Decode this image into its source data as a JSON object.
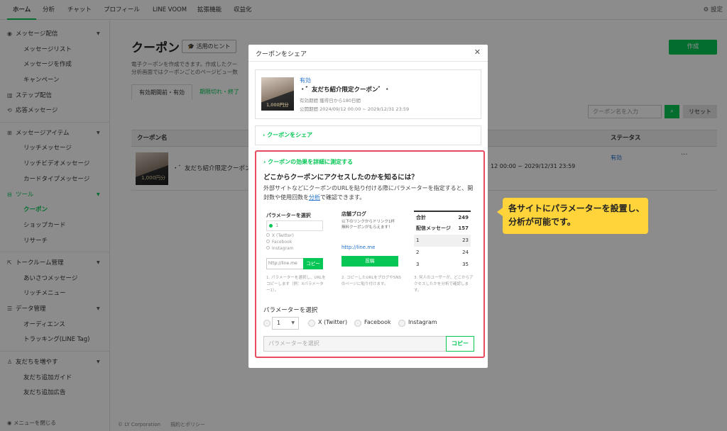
{
  "topnav": {
    "tabs": [
      "ホーム",
      "分析",
      "チャット",
      "プロフィール",
      "LINE VOOM",
      "拡張機能",
      "収益化"
    ],
    "settings": "設定"
  },
  "sidebar": {
    "sections": [
      {
        "label": "メッセージ配信",
        "items": [
          "メッセージリスト",
          "メッセージを作成",
          "キャンペーン"
        ]
      },
      {
        "label": "ステップ配信"
      },
      {
        "label": "応答メッセージ"
      },
      {
        "label": "メッセージアイテム",
        "items": [
          "リッチメッセージ",
          "リッチビデオメッセージ",
          "カードタイプメッセージ"
        ]
      },
      {
        "label": "ツール",
        "items": [
          "クーポン",
          "ショップカード",
          "リサーチ"
        ]
      },
      {
        "label": "トークルーム管理",
        "items": [
          "あいさつメッセージ",
          "リッチメニュー"
        ]
      },
      {
        "label": "データ管理",
        "items": [
          "オーディエンス",
          "トラッキング(LINE Tag)"
        ]
      },
      {
        "label": "友だちを増やす",
        "items": [
          "友だち追加ガイド",
          "友だち追加広告"
        ]
      }
    ],
    "close_label": "メニューを閉じる"
  },
  "main": {
    "title": "クーポン",
    "hint_button": "活用のヒント",
    "create_button": "作成",
    "desc_line1": "電子クーポンを作成できます。作成したクー",
    "desc_line2": "分析画面ではクーポンごとのページビュー数",
    "tab_active": "有効期間前・有効",
    "tab_other": "期限切れ・終了",
    "search_placeholder": "クーポン名を入力",
    "reset_button": "リセット",
    "col_name": "クーポン名",
    "col_status": "ステータス",
    "row_name": "・゛友だち紹介限定クーポン゛・",
    "row_period": "12 00:00 ~ 2029/12/31 23:59",
    "row_status": "有効",
    "row_more": "···",
    "footer": "© LY Corporation　　規約とポリシー"
  },
  "modal": {
    "title": "クーポンをシェア",
    "close": "✕",
    "card_status": "有効",
    "card_name": "・゛友だち紹介限定クーポン゛・",
    "card_line1": "有効期間 獲得日から180日間",
    "card_line2": "公開期間 2024/09/12 00:00 ~ 2029/12/31 23:59",
    "thumb_text": "1,000円分",
    "share_section": "クーポンをシェア",
    "measure_section": "クーポンの効果を詳細に測定する",
    "question": "どこからクーポンにアクセスしたのかを知るには？",
    "desc_before": "外部サイトなどにクーポンのURLを貼り付ける際にパラメーターを指定すると、開封数や使用回数を",
    "desc_link": "分析",
    "desc_after": "で確認できます。",
    "illus": {
      "c1_heading": "パラメーターを選択",
      "c1_select": "1",
      "c1_opts": [
        "X (Twitter)",
        "Facebook",
        "Instagram"
      ],
      "c1_url": "http://line.me",
      "c1_copy": "コピー",
      "c1_caption": "1. パラメーターを選択し、URLをコピーします（例：Xパラメーター1）。",
      "c2_heading": "店舗ブログ",
      "c2_text": "以下のリンクからドリンク1杯無料クーポンがもらえます！",
      "c2_link": "http://line.me",
      "c2_button": "投稿",
      "c2_caption": "2. コピーしたURLをブログやSNSのページに貼り付けます。",
      "table": [
        {
          "label": "合計",
          "value": "249"
        },
        {
          "label": "配信メッセージ",
          "value": "157"
        },
        {
          "label": "1",
          "value": "23"
        },
        {
          "label": "2",
          "value": "24"
        },
        {
          "label": "3",
          "value": "35"
        }
      ],
      "c3_caption": "3. 何人のユーザーが、どこからアクセスしたかを分析で確認します。"
    },
    "param_heading": "パラメーターを選択",
    "param_select": "1",
    "param_options": [
      "X (Twitter)",
      "Facebook",
      "Instagram"
    ],
    "param_placeholder": "パラメーターを選択",
    "param_copy": "コピー"
  },
  "callout": {
    "text": "各サイトにパラメーターを設置し、分析が可能です。"
  },
  "colors": {
    "accent": "#06c755",
    "highlight": "#e84a5f",
    "callout": "#ffd43b",
    "link": "#1f6fcc"
  }
}
